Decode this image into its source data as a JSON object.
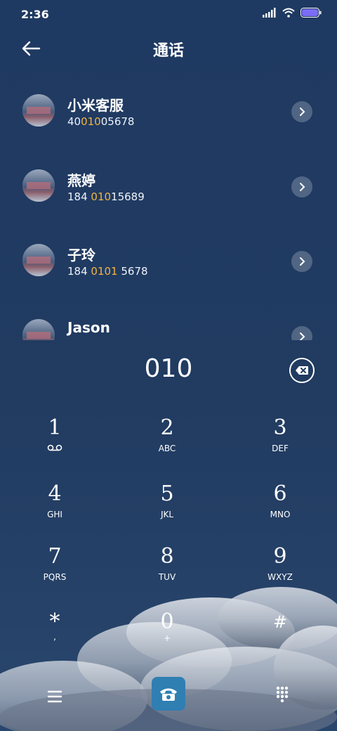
{
  "status_bar": {
    "time": "2:36",
    "icons": [
      "signal-icon",
      "wifi-icon",
      "battery-icon"
    ],
    "battery_color": "#7b6cf5"
  },
  "header": {
    "title": "通话",
    "back_icon": "arrow-left-icon"
  },
  "contacts": [
    {
      "name": "小米客服",
      "number_pre": "40",
      "number_match": "010",
      "number_post": "05678"
    },
    {
      "name": "燕婷",
      "number_pre": "184 ",
      "number_match": "010",
      "number_post": "15689"
    },
    {
      "name": "子玲",
      "number_pre": "184 ",
      "number_match": "0101",
      "number_post": " 5678"
    },
    {
      "name": "Jason",
      "number_pre": "",
      "number_match": "",
      "number_post": ""
    }
  ],
  "dialed_number": "010",
  "keypad": [
    {
      "digit": "1",
      "letters": ""
    },
    {
      "digit": "2",
      "letters": "ABC"
    },
    {
      "digit": "3",
      "letters": "DEF"
    },
    {
      "digit": "4",
      "letters": "GHI"
    },
    {
      "digit": "5",
      "letters": "JKL"
    },
    {
      "digit": "6",
      "letters": "MNO"
    },
    {
      "digit": "7",
      "letters": "PQRS"
    },
    {
      "digit": "8",
      "letters": "TUV"
    },
    {
      "digit": "9",
      "letters": "WXYZ"
    },
    {
      "digit": "*",
      "letters": ","
    },
    {
      "digit": "0",
      "letters": "+"
    },
    {
      "digit": "#",
      "letters": ""
    }
  ],
  "colors": {
    "background": "#213a5f",
    "highlight": "#f2b443",
    "call_button": "#2f7fb3"
  }
}
